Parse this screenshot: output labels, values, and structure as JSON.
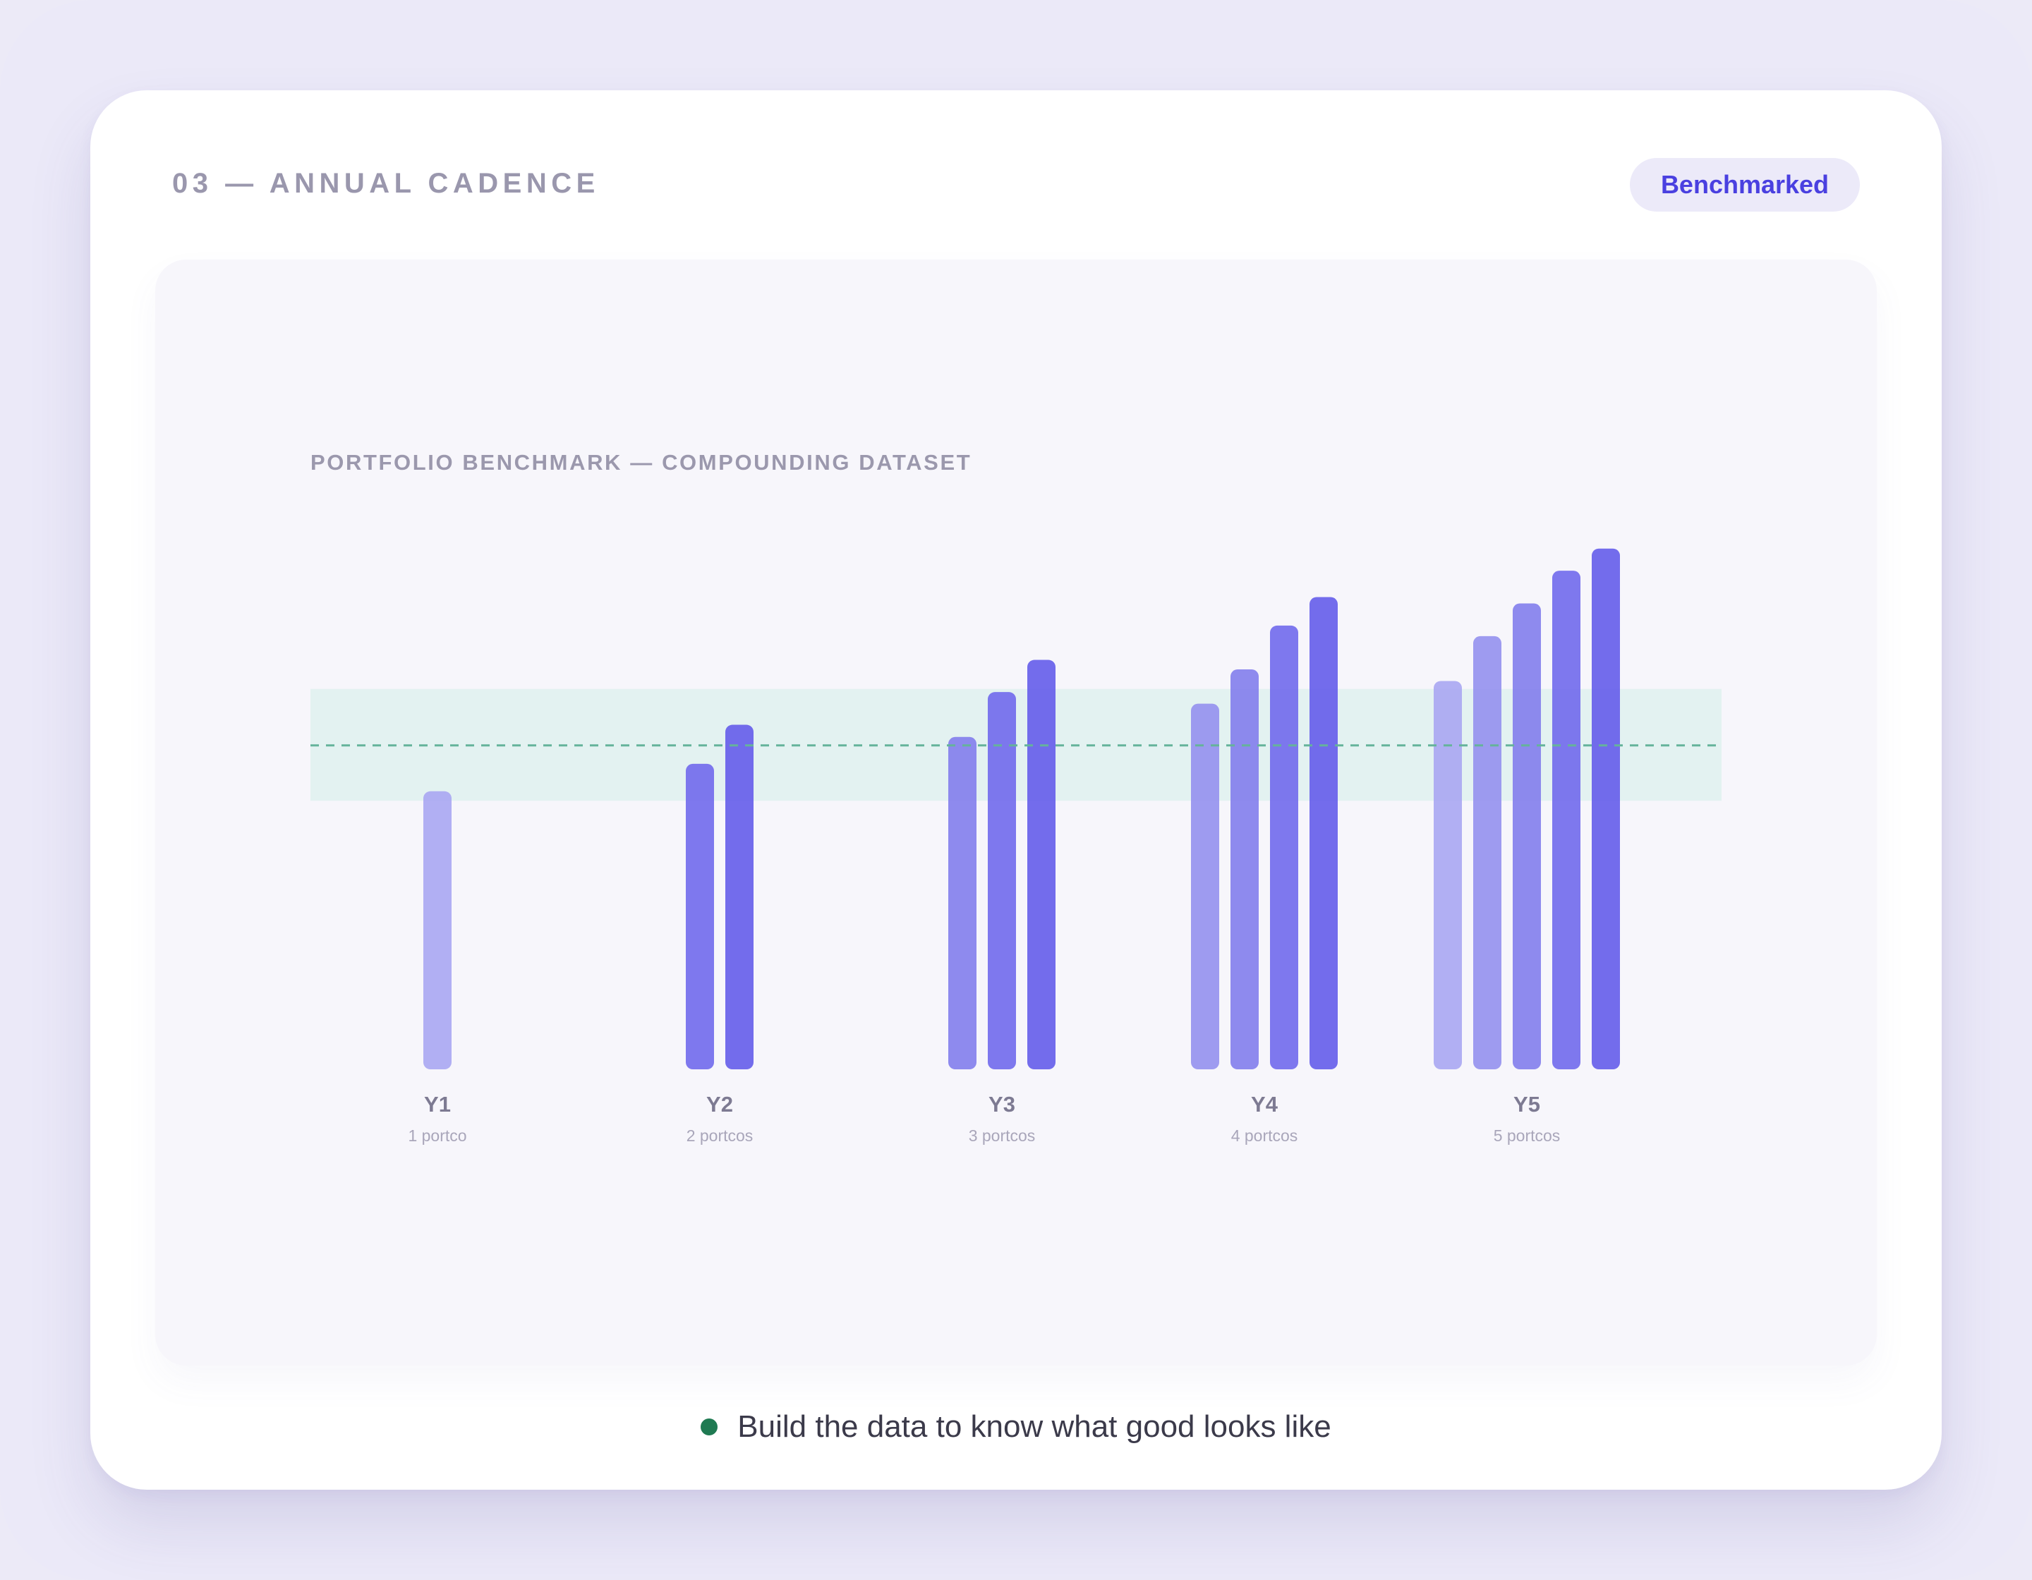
{
  "section_title": "03 — ANNUAL CADENCE",
  "badge": {
    "label": "Benchmarked"
  },
  "chart_title": "PORTFOLIO BENCHMARK — COMPOUNDING DATASET",
  "footer": {
    "text": "Build the data to know what good looks like"
  },
  "colors": {
    "background": "#ebe9f8",
    "card": "#ffffff",
    "panel": "#f7f6fb",
    "accent": "#4a40e0",
    "benchmark_band": "#dff1ee",
    "benchmark_line": "#65b39b",
    "bar_shades": [
      "#aaa8f2",
      "#9693ef",
      "#8480ed",
      "#736ded",
      "#6760ea"
    ],
    "footer_dot": "#1f7a52"
  },
  "chart_data": {
    "type": "bar",
    "title": "PORTFOLIO BENCHMARK — COMPOUNDING DATASET",
    "xlabel": "",
    "ylabel": "",
    "ylim": [
      0,
      100
    ],
    "grid": false,
    "categories": [
      "Y1",
      "Y2",
      "Y3",
      "Y4",
      "Y5"
    ],
    "category_sublabels": [
      "1 portco",
      "2 portcos",
      "3 portcos",
      "4 portcos",
      "5 portcos"
    ],
    "groups": [
      {
        "category": "Y1",
        "values": [
          52.7
        ]
      },
      {
        "category": "Y2",
        "values": [
          57.9,
          65.3
        ]
      },
      {
        "category": "Y3",
        "values": [
          63.0,
          71.5,
          77.6
        ]
      },
      {
        "category": "Y4",
        "values": [
          69.3,
          75.8,
          84.1,
          89.5
        ]
      },
      {
        "category": "Y5",
        "values": [
          73.6,
          82.1,
          88.3,
          94.5,
          98.7
        ]
      }
    ],
    "benchmark": {
      "value": 61.4,
      "band": [
        50.9,
        72.1
      ]
    }
  }
}
